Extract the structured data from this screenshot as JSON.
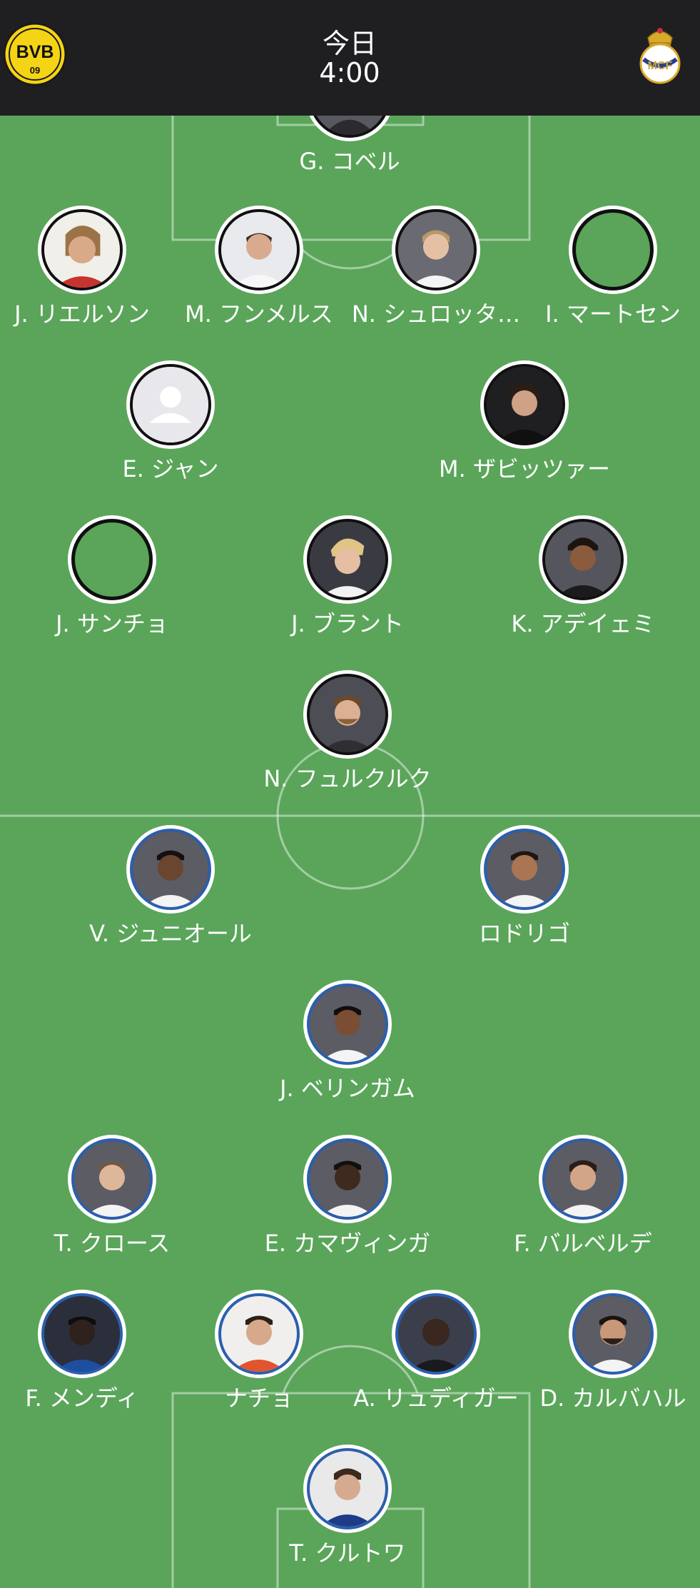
{
  "header": {
    "home_team": "BVB",
    "home_team_code": "09",
    "match_day": "今日",
    "match_time": "4:00",
    "away_team_crest_icon": "real-madrid-crest-icon"
  },
  "colors": {
    "pitch": "#5aa55a",
    "header_bg": "#1f1f22",
    "home_ring": "#101010",
    "away_ring": "#2b5fae",
    "bvb_yellow": "#f5d415"
  },
  "home_players": [
    {
      "name": "G. コベル",
      "photo": "partial"
    },
    {
      "name": "J. リエルソン",
      "photo": "photo"
    },
    {
      "name": "M. フンメルス",
      "photo": "photo"
    },
    {
      "name": "N. シュロッタ…",
      "photo": "photo"
    },
    {
      "name": "I. マートセン",
      "photo": "empty"
    },
    {
      "name": "E. ジャン",
      "photo": "placeholder"
    },
    {
      "name": "M. ザビッツァー",
      "photo": "photo"
    },
    {
      "name": "J. サンチョ",
      "photo": "empty"
    },
    {
      "name": "J. ブラント",
      "photo": "photo"
    },
    {
      "name": "K. アデイェミ",
      "photo": "photo"
    },
    {
      "name": "N. フュルクルク",
      "photo": "photo"
    }
  ],
  "away_players": [
    {
      "name": "V. ジュニオール",
      "photo": "photo"
    },
    {
      "name": "ロドリゴ",
      "photo": "photo"
    },
    {
      "name": "J. ベリンガム",
      "photo": "photo"
    },
    {
      "name": "T. クロース",
      "photo": "photo"
    },
    {
      "name": "E. カマヴィンガ",
      "photo": "photo"
    },
    {
      "name": "F. バルベルデ",
      "photo": "photo"
    },
    {
      "name": "F. メンディ",
      "photo": "photo"
    },
    {
      "name": "ナチョ",
      "photo": "photo"
    },
    {
      "name": "A. リュディガー",
      "photo": "photo"
    },
    {
      "name": "D. カルバハル",
      "photo": "photo"
    },
    {
      "name": "T. クルトワ",
      "photo": "photo"
    }
  ]
}
